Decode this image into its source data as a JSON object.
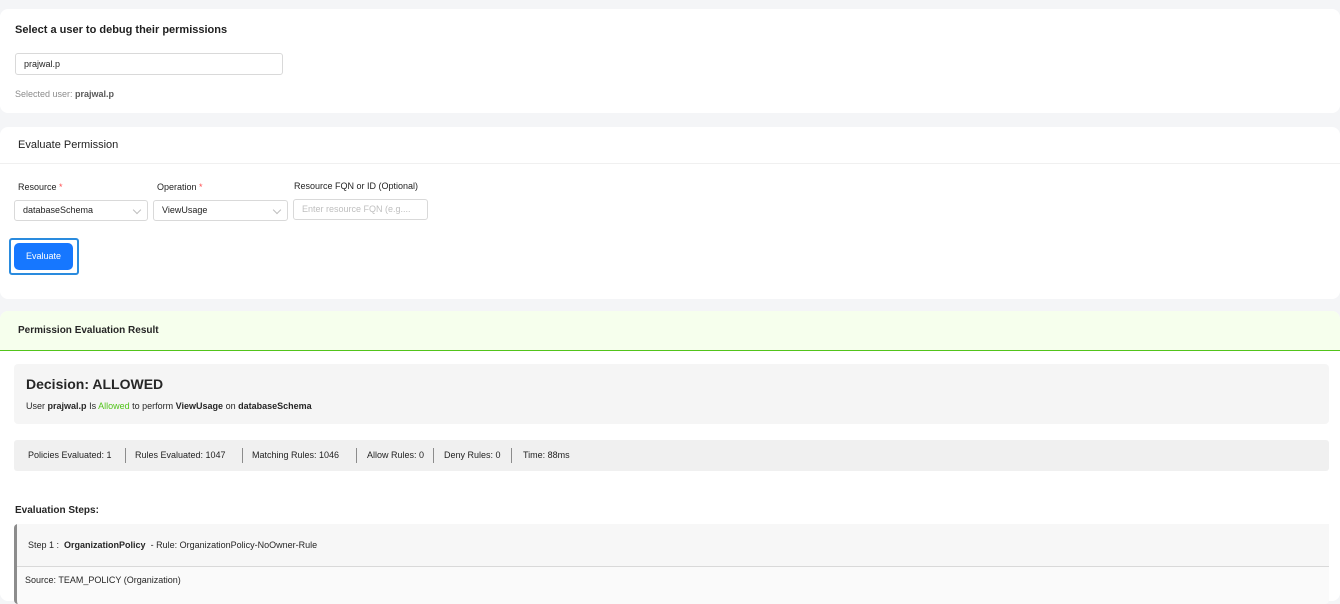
{
  "user_section": {
    "heading": "Select a user to debug their permissions",
    "user_input_value": "prajwal.p",
    "selected_prefix": "Selected user: ",
    "selected_user": "prajwal.p"
  },
  "evaluate_section": {
    "title": "Evaluate Permission",
    "resource_label": "Resource",
    "resource_value": "databaseSchema",
    "operation_label": "Operation",
    "operation_value": "ViewUsage",
    "fqn_label": "Resource FQN or ID (Optional)",
    "fqn_placeholder": "Enter resource FQN (e.g....",
    "required_mark": "*",
    "evaluate_button": "Evaluate"
  },
  "result_section": {
    "title": "Permission Evaluation Result",
    "decision": "Decision: ALLOWED",
    "sentence": {
      "user_word": "User",
      "user": "prajwal.p",
      "is": "Is",
      "status": "Allowed",
      "to_perform": "to perform",
      "operation": "ViewUsage",
      "on": "on",
      "resource": "databaseSchema"
    },
    "stats": {
      "policies_evaluated": "Policies Evaluated: 1",
      "rules_evaluated": "Rules Evaluated: 1047",
      "matching_rules": "Matching Rules: 1046",
      "allow_rules": "Allow Rules: 0",
      "deny_rules": "Deny Rules: 0",
      "time": "Time: 88ms"
    },
    "steps_title": "Evaluation Steps:",
    "step": {
      "prefix": "Step 1 :",
      "policy": "OrganizationPolicy",
      "rule": "- Rule: OrganizationPolicy-NoOwner-Rule",
      "source": "Source: TEAM_POLICY (Organization)"
    },
    "colors": {
      "allowed": "#52c41a",
      "header_bg": "#f6ffed",
      "button": "#1677ff"
    }
  }
}
